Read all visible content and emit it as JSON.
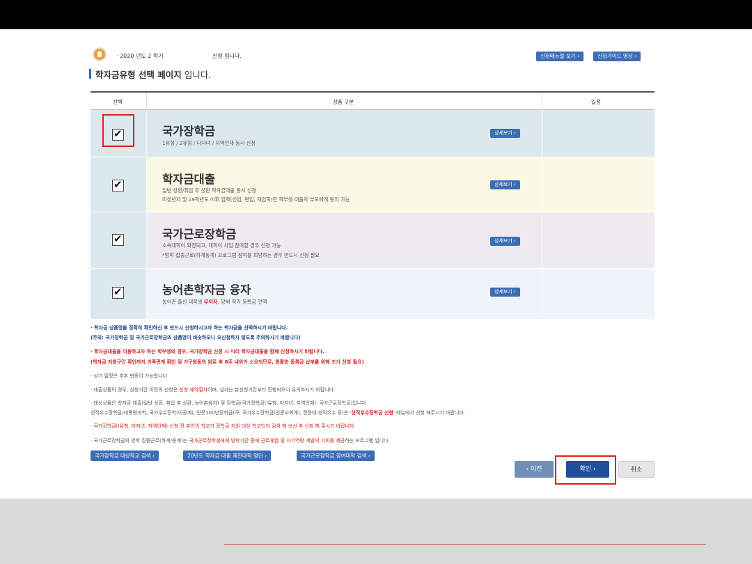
{
  "header": {
    "semester": "· 2020 년도 2 학기",
    "status": "신청 입니다.",
    "manual_btn": "신청매뉴얼 보기",
    "guide_btn": "신청가이드 영상"
  },
  "page_heading": {
    "bold": "학자금유형 선택 페이지",
    "rest": " 입니다."
  },
  "table": {
    "headers": {
      "select": "선택",
      "product": "상품 구분",
      "schedule": "일정"
    },
    "rows": [
      {
        "title": "국가장학금",
        "desc1": "1유형 / 2유형 / 다자녀 / 지역인재 동시 신청",
        "desc2": "",
        "detail": "상세보기",
        "checked": true,
        "bg": "#dbe9ef"
      },
      {
        "title": "학자금대출",
        "desc1": "일반 상환/취업 후 상환 학자금대출 동시 신청",
        "desc2": "미성년자 및 19학년도 이후 입학(신입, 편입, 재입학)한 학부생 대출자 부모에게 동의 가능",
        "detail": "상세보기",
        "checked": true,
        "bg": "#fbf8e6"
      },
      {
        "title": "국가근로장학금",
        "desc1": "소속대학이 확정되고, 대학이 사업 참여할 경우 신청 가능",
        "desc2": "*방학 집중근로(하계동계) 프로그램 참여를 희망하는 경우 반드시 신청 필요",
        "detail": "상세보기",
        "checked": true,
        "bg": "#efeaf0"
      },
      {
        "title": "농어촌학자금 융자",
        "desc1_a": "농어촌 출신 대학생 ",
        "desc1_red": "무이자",
        "desc1_b": ", 당해 학기 등록금 전액",
        "detail": "상세보기",
        "checked": true,
        "bg": "#eef4fa"
      }
    ]
  },
  "notes": {
    "n1a": "· 학자금 상품명을 정확히 확인하신 후 반드시 신청하시고자 하는 학자금을 선택하시기 바랍니다.",
    "n1b": "(주의: 국가장학금 및 국가근로장학금의 상품명이 비슷하오니 오신청하지 않도록 주의하시기 바랍니다)",
    "n2a": "· 학자금대출을 이용하고자 하는 학부생의 경우, 국가장학금 신청 시 미리 학자금대출을 함께 신청하시기 바랍니다.",
    "n2b": "(학자금 지원구간 확인까지 가족관계 확인 및 가구원동의 완료 후 8주 내외가 소요되므로, 원활한 등록금 납부를 위해 조기 신청 필요)",
    "n3": "· 상기 일정은 추후 변동이 가능합니다.",
    "n4a": "· 대출상품의 경우, 신청기간 이전의 신청은 ",
    "n4red": "신청 예약절차",
    "n4b": "이며, 실사는 본신청기간부터 진행되오니 유의하시기 바랍니다.",
    "n5a": "· 대상상품은 학자금 대출(일반 상환, 취업 후 상환, 농어촌융자) 및 장학금(국가장학금(Ⅰ유형, 다자녀, 지역인재), 국가근로장학금)입니다.",
    "n5b_a": "  성적우수장학금(대통령과학, 국가우수장학(이공계), 인문100년장학금(구, 국가우수장학금(인문사회계), 전문대 성적우수 등)은 '",
    "n5b_red": "성적우수장학금 신청",
    "n5b_b": "' 메뉴에서 신청 해주시기 바랍니다.",
    "n6": "· 국가장학금(Ⅰ유형, 다자녀, 지역인재) 신청 전 본인의 학교가 장학금 지원 대상 학교인지 검색 해 보신 후 신청 해 주시기 바랍니다.",
    "n7a": "· 국가근로장학금의 방학 집중근로(하계/동계)는 ",
    "n7red": "국가근로장학생에게 방학기간 중에 근로체험 및 자기역량 계발의 기회를 제공",
    "n7b": "하는 프로그램 입니다."
  },
  "links": {
    "school_search": "국가장학금 대상학교 검색",
    "restricted_univ": "20년도 학자금 대출 제한대학 명단",
    "work_univ_search": "국가근로장학금 참여대학 검색"
  },
  "nav": {
    "prev": "이전",
    "confirm": "확인",
    "cancel": "취소"
  },
  "colors": {
    "accent": "#3b6db4",
    "highlight": "#e31d1d",
    "confirm": "#1f4f9a"
  }
}
